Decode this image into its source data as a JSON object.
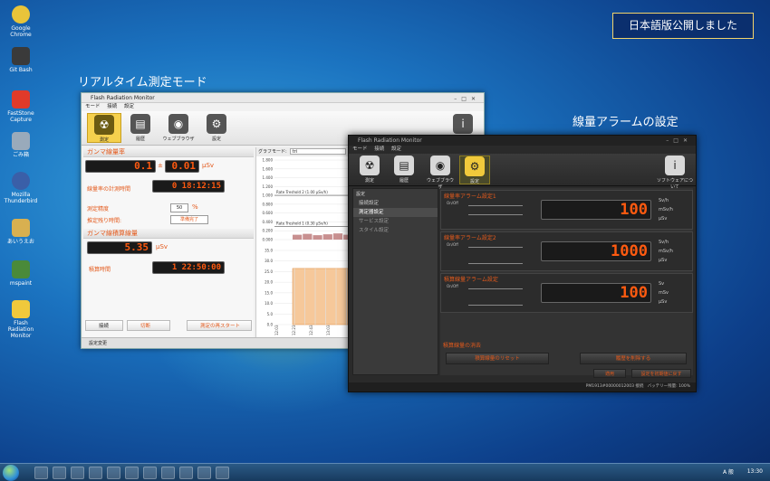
{
  "desktop": {
    "banner": "日本語版公開しました",
    "caption_realtime": "リアルタイム測定モード",
    "caption_alarm": "線量アラームの設定",
    "icons": [
      {
        "label": "Google Chrome",
        "color": "#e8c43a"
      },
      {
        "label": "Git Bash",
        "color": "#3a3a3a"
      },
      {
        "label": "FastStone Capture",
        "color": "#e03a2a"
      },
      {
        "label": "ごみ箱",
        "color": "#9ab"
      },
      {
        "label": "Mozilla Thunderbird",
        "color": "#3a5fa8"
      },
      {
        "label": "あいうえお",
        "color": "#d8b050"
      },
      {
        "label": "mspaint",
        "color": "#4a8a3a"
      },
      {
        "label": "Flash Radiation Monitor",
        "color": "#f0c93c"
      }
    ]
  },
  "light_window": {
    "title": "Flash Radiation Monitor",
    "menu": [
      "モード",
      "接続",
      "設定"
    ],
    "tools": [
      {
        "label": "測定",
        "icon": "☢"
      },
      {
        "label": "履歴",
        "icon": "▤"
      },
      {
        "label": "ウェブブラウザ",
        "icon": "◉"
      },
      {
        "label": "設定",
        "icon": "⚙"
      }
    ],
    "info_icon": "i",
    "section_rate": "ガンマ線量率",
    "rate_value": "0.1",
    "rate_pm": "±",
    "rate_err": "0.01",
    "rate_unit": "μSv",
    "elapsed_label": "線量率の計測時間",
    "elapsed_value": "0 18:12:15",
    "precision_label": "測定精度",
    "precision_value": "50",
    "precision_unit": "%",
    "eta_label": "推定残り時間:",
    "eta_value": "準備完了",
    "section_dose": "ガンマ線積算線量",
    "dose_value": "5.35",
    "dose_unit": "μSv",
    "dose_time_label": "積算時間",
    "dose_time_value": "1 22:50:00",
    "btn_connect": "接続",
    "btn_disconnect": "切断",
    "btn_restart": "測定の再スタート",
    "status": "設定変更",
    "graph_mode_label": "グラフモード:",
    "graph_mode_value": "tri",
    "threshold2": "Rate Treshold 2 (1.00 μSv/h)",
    "threshold1": "Rate Treshold 1 (0.30 μSv/h)"
  },
  "chart_data": [
    {
      "type": "line",
      "title": "",
      "y_ticks": [
        "1.800",
        "1.600",
        "1.400",
        "1.200",
        "1.000",
        "0.800",
        "0.600",
        "0.400",
        "0.200",
        "0.000"
      ],
      "ylim": [
        0,
        1.8
      ],
      "series": [
        {
          "name": "Rate Treshold 2 (1.00 μSv/h)",
          "values": [
            1.0,
            1.0
          ]
        },
        {
          "name": "Rate Treshold 1 (0.30 μSv/h)",
          "values": [
            0.3,
            0.3
          ]
        }
      ],
      "rate_points": [
        0.11,
        0.13,
        0.1,
        0.12,
        0.14,
        0.11,
        0.1,
        0.13,
        0.12,
        0.11,
        0.12,
        0.1,
        0.13,
        0.12,
        0.11,
        0.1,
        0.12,
        0.13
      ]
    },
    {
      "type": "area",
      "title": "",
      "y_ticks": [
        "35.0",
        "30.0",
        "25.0",
        "20.0",
        "15.0",
        "10.0",
        "5.0",
        "0.0"
      ],
      "ylim": [
        0,
        35
      ],
      "x_ticks": [
        "12:03",
        "12:23",
        "12:43",
        "13:03"
      ],
      "values": [
        26.5,
        26.5,
        26.5,
        26.5
      ]
    }
  ],
  "dark_window": {
    "title": "Flash Radiation Monitor",
    "menu": [
      "モード",
      "接続",
      "設定"
    ],
    "tools": [
      {
        "label": "測定",
        "icon": "☢"
      },
      {
        "label": "履歴",
        "icon": "▤"
      },
      {
        "label": "ウェブブラウザ",
        "icon": "◉"
      },
      {
        "label": "設定",
        "icon": "⚙"
      }
    ],
    "about_label": "ソフトウェアについて",
    "side_header": "設定",
    "side_items": [
      "接続設定",
      "測定器設定",
      "サービス設定",
      "スタイル設定"
    ],
    "groups": [
      {
        "title": "線量率アラーム設定1",
        "onoff": "On/Off",
        "value": "100",
        "radios": [
          "Sv/h",
          "mSv/h",
          "μSv"
        ]
      },
      {
        "title": "線量率アラーム設定2",
        "onoff": "On/Off",
        "value": "1000",
        "radios": [
          "Sv/h",
          "mSv/h",
          "μSv"
        ]
      },
      {
        "title": "積算線量アラーム設定",
        "onoff": "On/Off",
        "value": "100",
        "radios": [
          "Sv",
          "mSv",
          "μSv"
        ]
      }
    ],
    "reset_header": "積算線量の消去",
    "btn_reset": "積算線量のリセット",
    "btn_clear": "履歴を削除する",
    "btn_apply": "適用",
    "btn_default": "設定を初期値に戻す",
    "status": "PM1913#00000012003 接続",
    "battery": "バッテリー残量: 100%"
  },
  "taskbar": {
    "lang": "A 般",
    "clock": "13:30"
  }
}
